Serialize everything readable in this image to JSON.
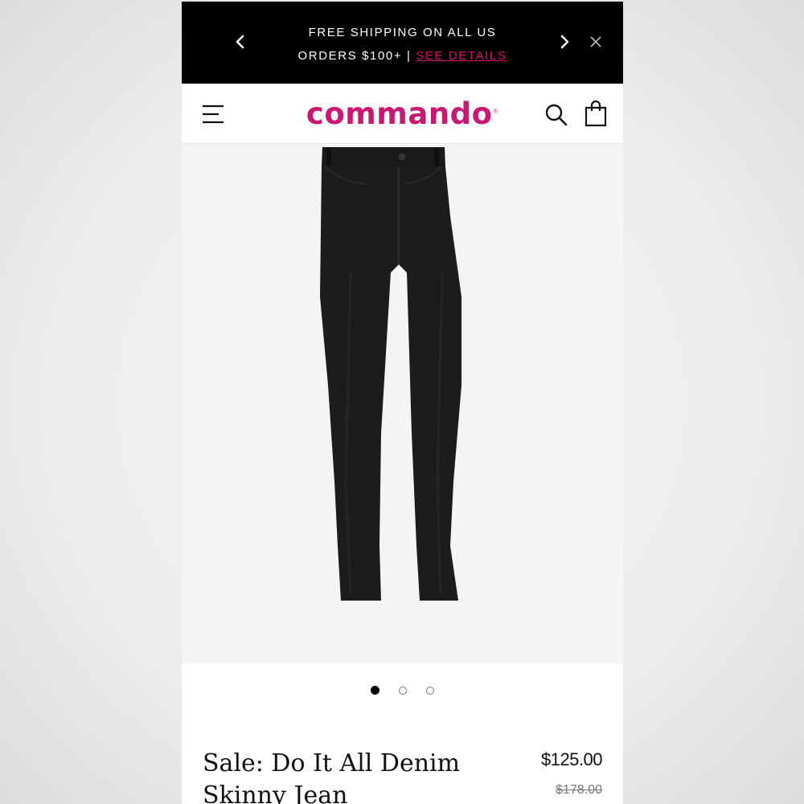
{
  "promo": {
    "line1": "FREE SHIPPING ON ALL US",
    "line2": "ORDERS $100+ |",
    "link": "SEE DETAILS",
    "prev_icon": "chevron-left-icon",
    "next_icon": "chevron-right-icon",
    "close_icon": "close-icon"
  },
  "header": {
    "logo": "commando",
    "logo_mark": "®",
    "menu_icon": "hamburger-menu-icon",
    "search_icon": "search-icon",
    "bag_icon": "shopping-bag-icon"
  },
  "carousel": {
    "total": 3,
    "active": 1
  },
  "product": {
    "name": "Sale: Do It All Denim Skinny Jean",
    "price": "$125.00",
    "original_price": "$178.00"
  },
  "colors": {
    "brand": "#c8186f",
    "link": "#d4146e",
    "banner": "#000000"
  }
}
